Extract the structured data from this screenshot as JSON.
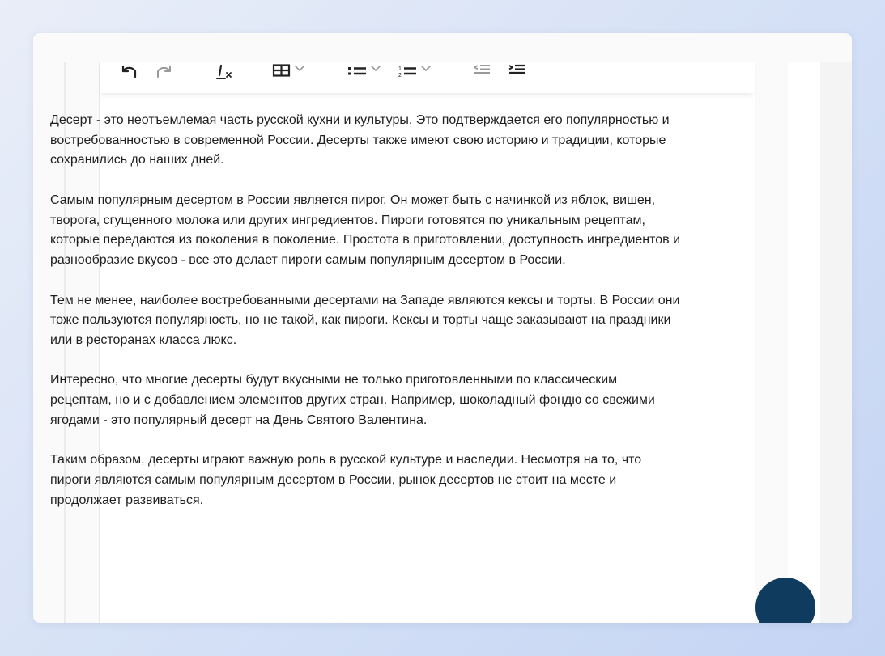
{
  "toolbar": {
    "icons": [
      "undo-icon",
      "redo-icon",
      "clear-formatting-icon",
      "table-icon",
      "chevron-down-icon",
      "bulleted-list-icon",
      "chevron-down-icon",
      "numbered-list-icon",
      "chevron-down-icon",
      "outdent-icon",
      "indent-icon"
    ]
  },
  "document": {
    "paragraphs": [
      "Десерт - это неотъемлемая часть русской кухни и культуры. Это подтверждается его популярностью и востребованностью в современной России. Десерты также имеют свою историю и традиции, которые сохранились до наших дней.",
      "Самым популярным десертом в России является пирог. Он может быть с начинкой из яблок, вишен, творога, сгущенного молока или других ингредиентов. Пироги готовятся по уникальным рецептам, которые передаются из поколения в поколение. Простота в приготовлении, доступность ингредиентов и разнообразие вкусов - все это делает пироги самым популярным десертом в России.",
      "Тем не менее, наиболее востребованными десертами на Западе являются кексы и торты. В России они тоже пользуются популярность, но не такой, как пироги. Кексы и торты чаще заказывают на праздники или в ресторанах класса люкс.",
      "Интересно, что многие десерты будут вкусными не только приготовленными по классическим рецептам, но и с добавлением элементов других стран. Например, шоколадный фондю со свежими ягодами - это популярный десерт на День Святого Валентина.",
      "Таким образом, десерты играют важную роль в русской культуре и наследии. Несмотря на то, что пироги являются самым популярным десертом в России, рынок десертов не стоит на месте и продолжает развиваться."
    ]
  },
  "colors": {
    "background": "#d4e0f6",
    "card": "#fafafa",
    "editor": "#ffffff",
    "text": "#1f1f1f",
    "icon": "#222222",
    "icon_muted": "#9a9a9a",
    "fab": "#0f3b5f"
  }
}
